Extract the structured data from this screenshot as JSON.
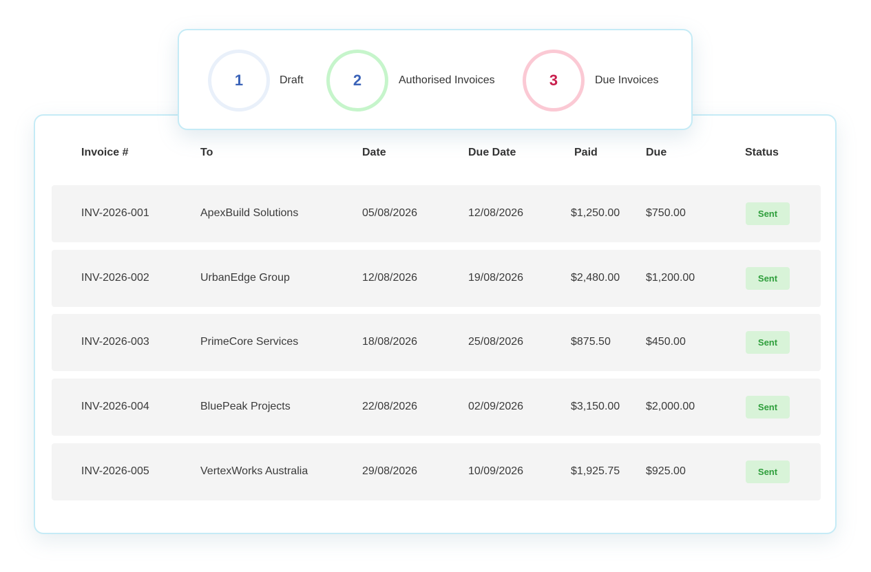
{
  "summary": {
    "items": [
      {
        "count": "1",
        "label": "Draft",
        "ring_color": "#e9f0fa",
        "number_color": "#3b63b8"
      },
      {
        "count": "2",
        "label": "Authorised Invoices",
        "ring_color": "#c6f5cb",
        "number_color": "#3b63b8"
      },
      {
        "count": "3",
        "label": "Due Invoices",
        "ring_color": "#fbc9d4",
        "number_color": "#c81e4c"
      }
    ]
  },
  "table": {
    "headers": {
      "invoice": "Invoice #",
      "to": "To",
      "date": "Date",
      "due_date": "Due Date",
      "paid": "Paid",
      "due": "Due",
      "status": "Status"
    },
    "rows": [
      {
        "invoice": "INV-2026-001",
        "to": "ApexBuild Solutions",
        "date": "05/08/2026",
        "due_date": "12/08/2026",
        "paid": "$1,250.00",
        "due": "$750.00",
        "status": "Sent"
      },
      {
        "invoice": "INV-2026-002",
        "to": "UrbanEdge Group",
        "date": "12/08/2026",
        "due_date": "19/08/2026",
        "paid": "$2,480.00",
        "due": "$1,200.00",
        "status": "Sent"
      },
      {
        "invoice": "INV-2026-003",
        "to": "PrimeCore Services",
        "date": "18/08/2026",
        "due_date": "25/08/2026",
        "paid": "$875.50",
        "due": "$450.00",
        "status": "Sent"
      },
      {
        "invoice": "INV-2026-004",
        "to": "BluePeak Projects",
        "date": "22/08/2026",
        "due_date": "02/09/2026",
        "paid": "$3,150.00",
        "due": "$2,000.00",
        "status": "Sent"
      },
      {
        "invoice": "INV-2026-005",
        "to": "VertexWorks Australia",
        "date": "29/08/2026",
        "due_date": "10/09/2026",
        "paid": "$1,925.75",
        "due": "$925.00",
        "status": "Sent"
      }
    ]
  },
  "colors": {
    "card_border": "#c5ebf6",
    "row_background": "#f4f4f4",
    "status_sent_bg": "#d8f3d8",
    "status_sent_text": "#2e9e3b"
  }
}
